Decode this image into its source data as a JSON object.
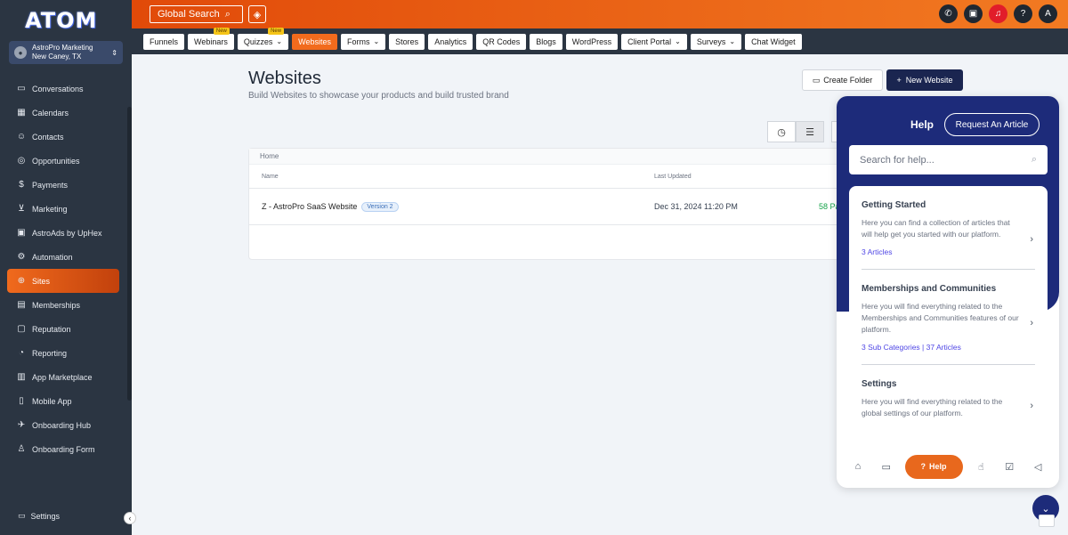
{
  "app": {
    "logo_text": "ATOM"
  },
  "account": {
    "name": "AstroPro Marketing",
    "location": "New Caney, TX"
  },
  "sidebar": {
    "items": [
      {
        "label": "Conversations",
        "icon": "chat-icon"
      },
      {
        "label": "Calendars",
        "icon": "calendar-icon"
      },
      {
        "label": "Contacts",
        "icon": "contacts-icon"
      },
      {
        "label": "Opportunities",
        "icon": "opportunities-icon"
      },
      {
        "label": "Payments",
        "icon": "payments-icon"
      },
      {
        "label": "Marketing",
        "icon": "marketing-icon"
      },
      {
        "label": "AstroAds by UpHex",
        "icon": "ads-icon"
      },
      {
        "label": "Automation",
        "icon": "automation-icon"
      },
      {
        "label": "Sites",
        "icon": "globe-icon",
        "active": true
      },
      {
        "label": "Memberships",
        "icon": "memberships-icon"
      },
      {
        "label": "Reputation",
        "icon": "reputation-icon"
      },
      {
        "label": "Reporting",
        "icon": "reporting-icon"
      },
      {
        "label": "App Marketplace",
        "icon": "marketplace-icon"
      },
      {
        "label": "Mobile App",
        "icon": "mobile-icon"
      },
      {
        "label": "Onboarding Hub",
        "icon": "onboarding-icon"
      },
      {
        "label": "Onboarding Form",
        "icon": "onboarding-form-icon"
      }
    ],
    "settings_label": "Settings"
  },
  "topbar": {
    "global_search_label": "Global Search"
  },
  "tabs": [
    {
      "label": "Funnels"
    },
    {
      "label": "Webinars",
      "badge": "New"
    },
    {
      "label": "Quizzes",
      "badge": "New",
      "dropdown": true
    },
    {
      "label": "Websites",
      "active": true
    },
    {
      "label": "Forms",
      "dropdown": true
    },
    {
      "label": "Stores"
    },
    {
      "label": "Analytics"
    },
    {
      "label": "QR Codes"
    },
    {
      "label": "Blogs"
    },
    {
      "label": "WordPress"
    },
    {
      "label": "Client Portal",
      "dropdown": true
    },
    {
      "label": "Surveys",
      "dropdown": true
    },
    {
      "label": "Chat Widget"
    }
  ],
  "page": {
    "title": "Websites",
    "subtitle": "Build Websites to showcase your products and build trusted brand",
    "create_folder_label": "Create Folder",
    "new_website_label": "New Website"
  },
  "table": {
    "breadcrumb": "Home",
    "columns": {
      "name": "Name",
      "last_updated": "Last Updated"
    },
    "rows": [
      {
        "name": "Z - AstroPro SaaS Website",
        "version": "Version 2",
        "last_updated": "Dec 31, 2024 11:20 PM",
        "pages": "58 Pa"
      }
    ]
  },
  "help": {
    "title": "Help",
    "request_article_label": "Request An Article",
    "search_placeholder": "Search for help...",
    "categories": [
      {
        "title": "Getting Started",
        "description": "Here you can find a collection of articles that will help get you started with our platform.",
        "meta": "3 Articles"
      },
      {
        "title": "Memberships and Communities",
        "description": "Here you will find everything related to the Memberships and Communities features of our platform.",
        "meta": "3 Sub Categories | 37 Articles"
      },
      {
        "title": "Settings",
        "description": "Here you will find everything related to the global settings of our platform.",
        "meta": ""
      }
    ],
    "footer_help_label": "Help"
  },
  "colors": {
    "accent": "#f26b1d",
    "navy": "#1d2b7a",
    "sidebar": "#2b3542"
  }
}
